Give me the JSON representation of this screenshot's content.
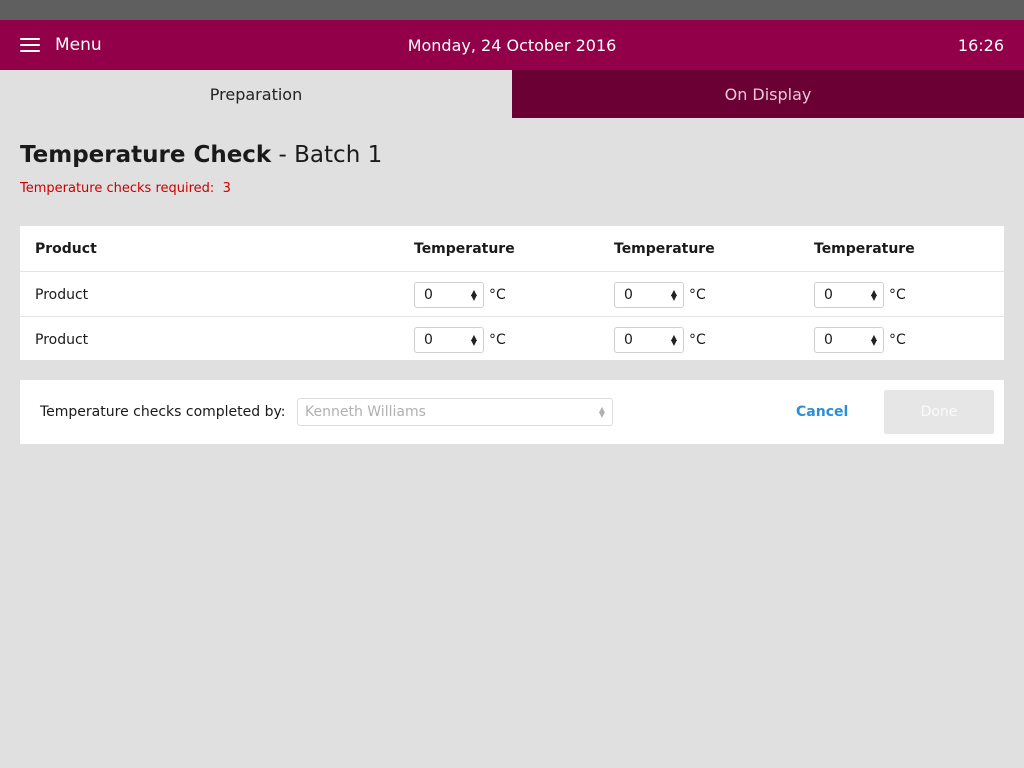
{
  "header": {
    "menu_label": "Menu",
    "date": "Monday, 24 October 2016",
    "time": "16:26",
    "brand_color": "#93004a"
  },
  "tabs": [
    {
      "label": "Preparation",
      "active": true
    },
    {
      "label": "On Display",
      "active": false
    }
  ],
  "page": {
    "title_main": "Temperature Check",
    "title_separator": " - ",
    "title_batch": "Batch 1",
    "required_label": "Temperature checks required:",
    "required_count": "3",
    "required_color": "#cc0000"
  },
  "table": {
    "columns": [
      "Product",
      "Temperature",
      "Temperature",
      "Temperature"
    ],
    "rows": [
      {
        "product": "Product",
        "temps": [
          "0",
          "0",
          "0"
        ]
      },
      {
        "product": "Product",
        "temps": [
          "0",
          "0",
          "0"
        ]
      }
    ],
    "unit": "°C"
  },
  "footer": {
    "completed_by_label": "Temperature checks completed by:",
    "completed_by_placeholder": "Kenneth Williams",
    "cancel_label": "Cancel",
    "done_label": "Done",
    "link_color": "#2b8fd6"
  },
  "icons": {
    "menu": "hamburger-icon",
    "stepper": "spinner-arrows-icon",
    "select": "select-arrows-icon"
  }
}
